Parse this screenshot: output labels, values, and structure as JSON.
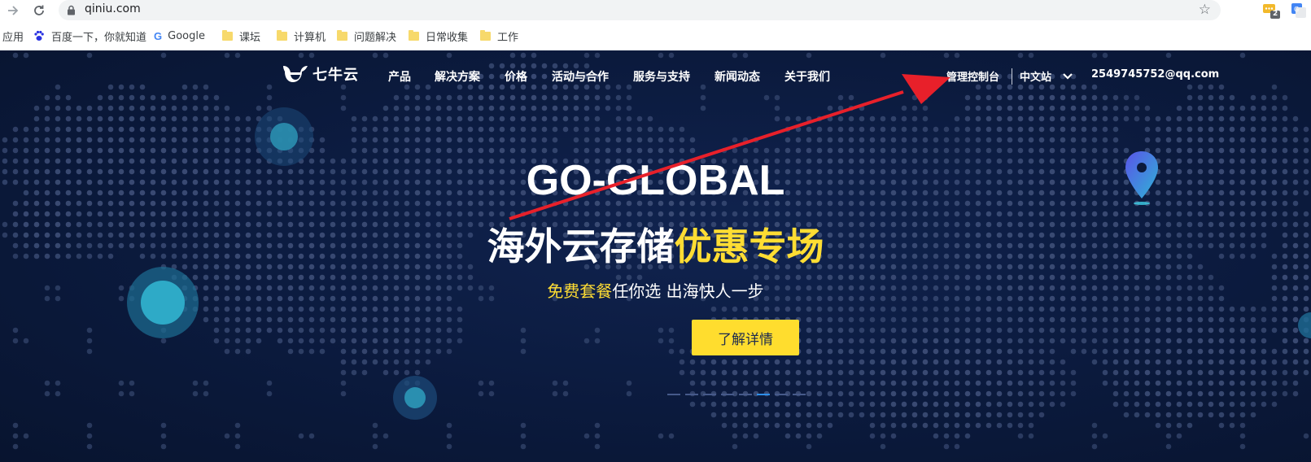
{
  "browser": {
    "url": "qiniu.com",
    "extension_badge": "2"
  },
  "bookmarks": {
    "apps_label": "应用",
    "items": [
      {
        "label": "百度一下，你就知道",
        "icon": "baidu-paw-icon"
      },
      {
        "label": "Google",
        "icon": "google-g-icon"
      },
      {
        "label": "课坛",
        "icon": "folder-icon"
      },
      {
        "label": "计算机",
        "icon": "folder-icon"
      },
      {
        "label": "问题解决",
        "icon": "folder-icon"
      },
      {
        "label": "日常收集",
        "icon": "folder-icon"
      },
      {
        "label": "工作",
        "icon": "folder-icon"
      }
    ]
  },
  "site": {
    "logo_text": "七牛云",
    "nav": [
      "产品",
      "解决方案",
      "价格",
      "活动与合作",
      "服务与支持",
      "新闻动态",
      "关于我们"
    ],
    "console_link": "管理控制台",
    "language": "中文站",
    "account": "2549745752@qq.com"
  },
  "hero": {
    "headline": "GO-GLOBAL",
    "sub_headline_white": "海外云存储",
    "sub_headline_yellow": "优惠专场",
    "tagline_yellow": "免费套餐",
    "tagline_white": "任你选 出海快人一步",
    "cta_label": "了解详情",
    "slide_count": 8,
    "active_slide": 5
  },
  "colors": {
    "background": "#0b1a3d",
    "accent_yellow": "#ffdd33",
    "annotation_arrow": "#e8202a"
  }
}
